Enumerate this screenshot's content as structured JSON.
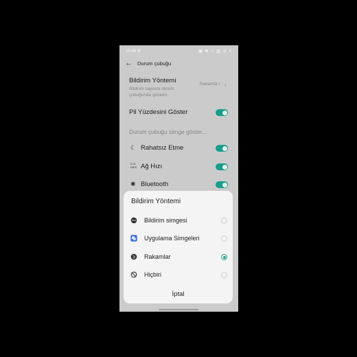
{
  "statusbar": {
    "time": "15:48 ⚙",
    "icons": "▣ ✱ ◇ ▥ ◎ 4"
  },
  "header": {
    "back_icon": "←",
    "title": "Durum çubuğu"
  },
  "settings": {
    "notification_method": {
      "label": "Bildirim Yöntemi",
      "subtitle": "Bildirim sayısını durum çubuğunda gösterir.",
      "value": "Rakamla r",
      "chevron": "›"
    },
    "battery_percent": {
      "label": "Pil Yüzdesini Göster",
      "on": true
    },
    "section_label": "Durum çubuğu simge göster...",
    "do_not_disturb": {
      "label": "Rahatsız Etme",
      "icon": "☾",
      "on": true
    },
    "network_speed": {
      "label": "Ağ Hızı",
      "icon": "0.01 KB/S",
      "on": true
    },
    "bluetooth": {
      "label": "Bluetooth",
      "icon": "✱",
      "on": true
    }
  },
  "sheet": {
    "title": "Bildirim Yöntemi",
    "options": [
      {
        "label": "Bildirim simgesi",
        "icon": "chat-bubble-icon",
        "selected": false
      },
      {
        "label": "Uygulama Simgeleri",
        "icon": "app-icons-icon",
        "selected": false
      },
      {
        "label": "Rakamlar",
        "icon": "number-badge-icon",
        "selected": true
      },
      {
        "label": "Hiçbiri",
        "icon": "ban-icon",
        "selected": false
      }
    ],
    "cancel_label": "İptal"
  },
  "colors": {
    "accent": "#1aa390",
    "screen_bg": "#d2d2d2",
    "sheet_bg": "#f4f4f4"
  }
}
